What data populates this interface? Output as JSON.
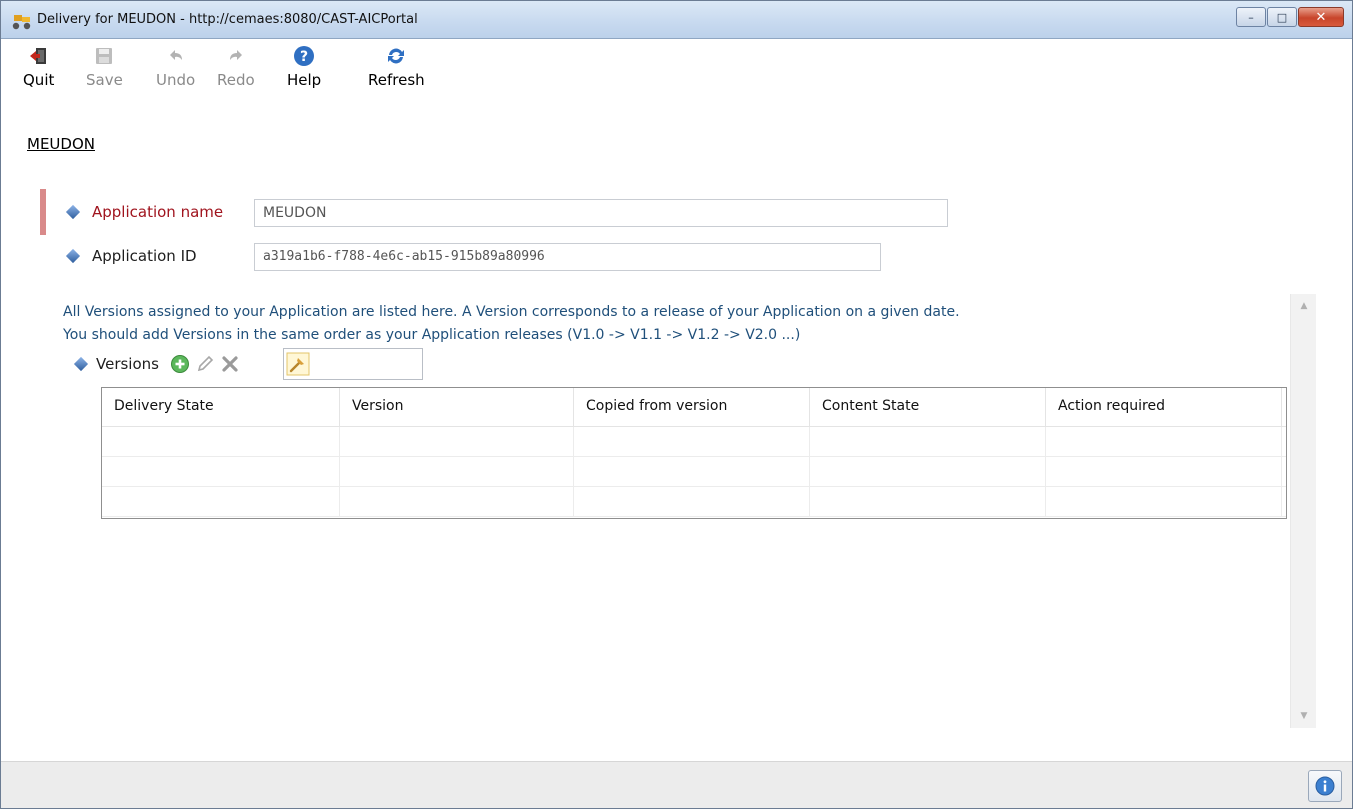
{
  "window": {
    "title": "Delivery for MEUDON - http://cemaes:8080/CAST-AICPortal",
    "controls": {
      "minimize": "–",
      "maximize": "□",
      "close": "✕"
    }
  },
  "toolbar": {
    "quit": "Quit",
    "save": "Save",
    "undo": "Undo",
    "redo": "Redo",
    "help": "Help",
    "refresh": "Refresh"
  },
  "breadcrumb": "MEUDON",
  "form": {
    "app_name_label": "Application name",
    "app_name_value": "MEUDON",
    "app_id_label": "Application ID",
    "app_id_value": "a319a1b6-f788-4e6c-ab15-915b89a80996"
  },
  "versions": {
    "help_line1": "All Versions assigned to your Application are listed here. A Version corresponds to a release of your Application on a given date.",
    "help_line2": "You should add Versions in the same order as your Application releases (V1.0 -> V1.1 -> V1.2 -> V2.0 ...)",
    "label": "Versions",
    "filter_value": "",
    "columns": [
      "Delivery State",
      "Version",
      "Copied from version",
      "Content State",
      "Action required"
    ]
  },
  "colors": {
    "required_label": "#a0141e",
    "help_text": "#1f4f7a",
    "required_marker": "#d98a8a"
  },
  "icons": [
    "app-icon",
    "quit-icon",
    "save-icon",
    "undo-icon",
    "redo-icon",
    "help-icon",
    "refresh-icon",
    "diamond-icon",
    "add-icon",
    "edit-icon",
    "delete-icon",
    "filter-icon",
    "info-icon"
  ]
}
